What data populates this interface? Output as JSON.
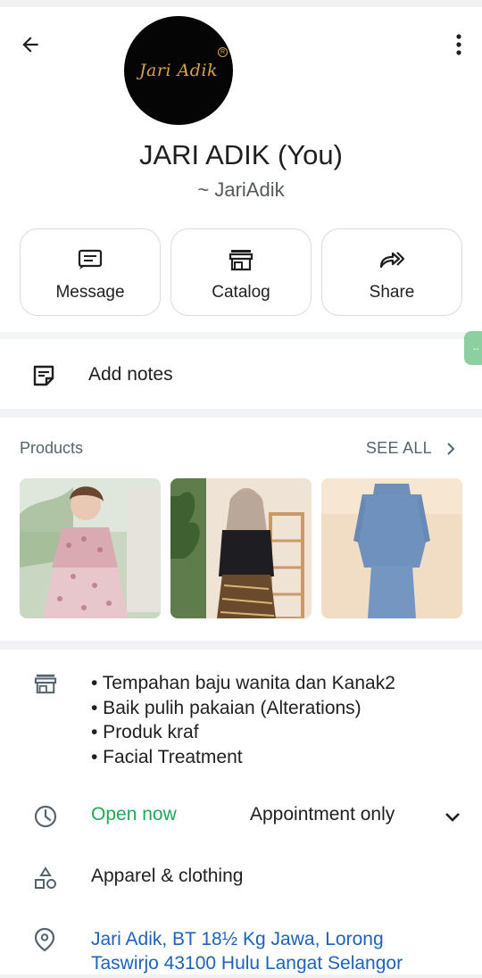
{
  "header": {
    "back_icon": "arrow-left-icon",
    "more_icon": "more-vertical-icon"
  },
  "profile": {
    "avatar_logo_text": "Jari Adik",
    "name": "JARI ADIK (You)",
    "username": "~ JariAdik"
  },
  "actions": [
    {
      "label": "Message",
      "icon": "message-icon"
    },
    {
      "label": "Catalog",
      "icon": "storefront-icon"
    },
    {
      "label": "Share",
      "icon": "share-arrow-icon"
    }
  ],
  "notes": {
    "label": "Add notes",
    "icon": "notes-icon"
  },
  "products": {
    "heading": "Products",
    "see_all": "SEE ALL",
    "items": [
      {
        "icon": "product-thumbnail-floral-girl-dress"
      },
      {
        "icon": "product-thumbnail-black-top-batik-skirt"
      },
      {
        "icon": "product-thumbnail-blue-kurung"
      }
    ]
  },
  "business": {
    "services": [
      "• Tempahan baju wanita dan Kanak2",
      "• Baik pulih pakaian (Alterations)",
      "• Produk kraf",
      "• Facial Treatment"
    ],
    "hours_status": "Open now",
    "hours_note": "Appointment only",
    "category": "Apparel & clothing",
    "address": " Jari Adik, BT 18½ Kg Jawa, Lorong\nTaswirjo 43100 Hulu Langat Selangor"
  },
  "colors": {
    "accent_green": "#1fa855",
    "link_blue": "#1d63b8",
    "secondary_text": "#54656f"
  }
}
